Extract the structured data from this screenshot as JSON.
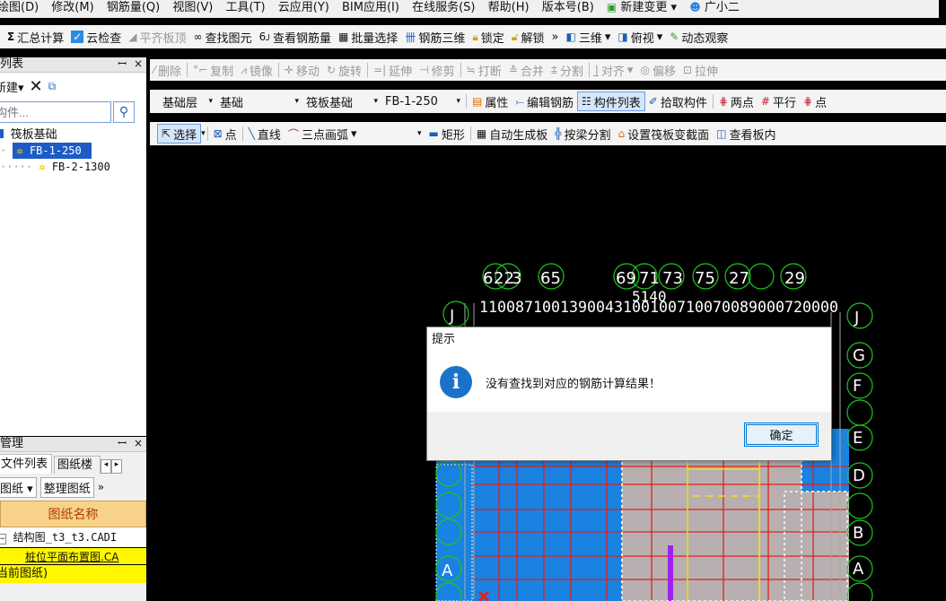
{
  "menu": [
    "绘图(D)",
    "修改(M)",
    "钢筋量(Q)",
    "视图(V)",
    "工具(T)",
    "云应用(Y)",
    "BIM应用(I)",
    "在线服务(S)",
    "帮助(H)",
    "版本号(B)",
    "新建变更",
    "广小二"
  ],
  "toolbar1": {
    "sum": "汇总计算",
    "cloud_check": "云检查",
    "flush_slab": "平齐板顶",
    "find_elem": "查找图元",
    "view_rebar_qty": "查看钢筋量",
    "batch_select": "批量选择",
    "rebar_3d": "钢筋三维",
    "lock": "锁定",
    "unlock": "解锁",
    "more": "»",
    "view_3d": "三维",
    "top_view": "俯视",
    "dynamic_observe": "动态观察"
  },
  "toolbar2": {
    "delete": "删除",
    "copy": "复制",
    "mirror": "镜像",
    "move": "移动",
    "rotate": "旋转",
    "extend": "延伸",
    "trim": "修剪",
    "break": "打断",
    "merge": "合并",
    "split": "分割",
    "align": "对齐",
    "offset": "偏移",
    "stretch": "拉伸"
  },
  "toolbar3": {
    "floor": "基础层",
    "category": "基础",
    "type": "筏板基础",
    "element": "FB-1-250",
    "property": "属性",
    "edit_rebar": "编辑钢筋",
    "component_list": "构件列表",
    "pick_component": "拾取构件",
    "two_points": "两点",
    "parallel": "平行",
    "point_angle": "点"
  },
  "toolbar4": {
    "select": "选择",
    "point": "点",
    "line": "直线",
    "arc": "三点画弧",
    "rect": "矩形",
    "auto_gen": "自动生成板",
    "split_by_beam": "按梁分割",
    "set_section": "设置筏板变截面",
    "view_board": "查看板内"
  },
  "left_panel": {
    "title": "列表",
    "pin": "ꟷ",
    "close": "×",
    "new_label": "新建",
    "search_placeholder": "构件...",
    "tree_root": "筏板基础",
    "items": [
      "FB-1-250",
      "FB-2-1300"
    ]
  },
  "drawing_panel": {
    "title": "管理",
    "pin": "ꟷ",
    "close": "×",
    "tab1": "文件列表",
    "tab2": "图纸楼",
    "btn_drawing": "图纸",
    "btn_organize": "整理图纸",
    "col_header": "图纸名称",
    "rows": [
      "结构图_t3_t3.CADI",
      "桩位平面布置图.CA",
      "当前图纸)"
    ]
  },
  "canvas": {
    "top_axes": [
      "6",
      "22",
      "3",
      "65",
      "69",
      "71",
      "73",
      "75",
      "27",
      "29"
    ],
    "dims": "1100871001390043100100710070089000720000",
    "dims2": "5140",
    "row_labels_right": [
      "J",
      "G",
      "F",
      "E",
      "D",
      "B",
      "A"
    ],
    "row_labels_left": [
      "J",
      "A"
    ]
  },
  "dialog": {
    "title": "提示",
    "message": "没有查找到对应的钢筋计算结果！",
    "ok": "确定"
  },
  "colors": {
    "accent": "#1e5bc6",
    "canvas_bg": "#000000",
    "slab_fill": "#1a82e0",
    "axis_green": "#1ec51e"
  }
}
